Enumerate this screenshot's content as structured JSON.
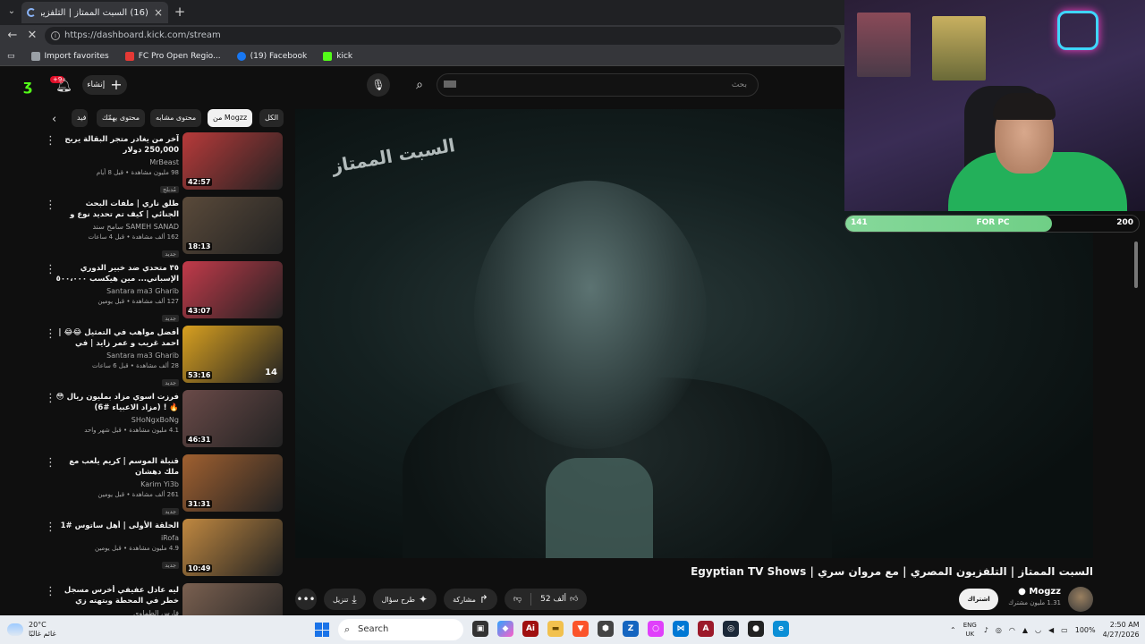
{
  "browser": {
    "tab_title": "(16) السبت الممتاز | التلفزيون المصر",
    "url": "https://dashboard.kick.com/stream",
    "bookmarks": [
      {
        "label": "Import favorites",
        "color": "#9aa0a6"
      },
      {
        "label": "FC Pro Open Regio...",
        "color": "#e53935"
      },
      {
        "label": "(19) Facebook",
        "color": "#1877f2"
      },
      {
        "label": "kick",
        "color": "#53fc18"
      }
    ]
  },
  "header": {
    "notif_badge": "+9",
    "create_label": "إنشاء",
    "search_placeholder": "بحث"
  },
  "chips": [
    {
      "label": "الكل",
      "active": false
    },
    {
      "label": "من Mogzz",
      "active": true
    },
    {
      "label": "محتوى مشابه",
      "active": false
    },
    {
      "label": "محتوى يهمّك",
      "active": false
    },
    {
      "label": "فيد",
      "active": false
    }
  ],
  "videos": [
    {
      "title": "آخر من يغادر متجر البقالة يربح 250,000 دولار",
      "channel": "MrBeast",
      "meta": "98 مليون مشاهدة • قبل 8 أيام",
      "badge": "مُدبلج",
      "duration": "42:57",
      "thumb": "#b83a3a"
    },
    {
      "title": "طلق ناري | ملفات البحث الجنائي | كيف تم تحديد نوع و بصمة السلاح و تفاصيل هامة ...",
      "channel": "SAMEH SANAD سامح سند",
      "meta": "162 ألف مشاهدة • قبل 4 ساعات",
      "badge": "جديد",
      "duration": "18:13",
      "thumb": "#5a4a3a"
    },
    {
      "title": "٣٥ متحدي ضد خبير الدوري الإسباني... مين هيكسب ٥٠٠،٠٠٠ جنيه 😳",
      "channel": "Santara ma3 Gharib",
      "meta": "127 ألف مشاهدة • قبل يومين",
      "badge": "جديد",
      "duration": "43:07",
      "thumb": "#c23a4a"
    },
    {
      "title": "أفضل مواهب في التمثيل 😂😂 | احمد غريب و عمر زايد | في السجين مع سين جيم في ال 70 و",
      "channel": "Santara ma3 Gharib",
      "meta": "28 ألف مشاهدة • قبل 6 ساعات",
      "badge": "جديد",
      "duration": "53:16",
      "thumb": "#d8a020",
      "tag": "14"
    },
    {
      "title": "فرزت اسوي مزاد بمليون ريال 😳🔥 ! (مزاد الاعبياء #6)",
      "channel": "SHoNgxBoNg",
      "meta": "4.1 مليون مشاهدة • قبل شهر واحد",
      "badge": "",
      "duration": "46:31",
      "thumb": "#6a4a48"
    },
    {
      "title": "قنبلة الموسم | كريم يلعب مع ملك دهشان",
      "channel": "Karim Yi3b",
      "meta": "261 ألف مشاهدة • قبل يومين",
      "badge": "جديد",
      "duration": "31:31",
      "thumb": "#a06030"
    },
    {
      "title": "الحلقة الأولى | أهل ساتوس #1",
      "channel": "iRofa",
      "meta": "4.9 مليون مشاهدة • قبل يومين",
      "badge": "جديد",
      "duration": "10:49",
      "thumb": "#c08840"
    },
    {
      "title": "ليه عادل عفيفي أخرس مسجل خطر في المحطة وبتهته زي المسلسلات | حكاوي ...",
      "channel": "فارس الطماوي",
      "meta": "",
      "badge": "",
      "duration": "",
      "thumb": "#7a6050"
    }
  ],
  "player": {
    "watermark": "السبت الممتاز",
    "title": "السبت الممتاز | التلفزيون المصري | مع مروان سري | Egyptian TV Shows"
  },
  "actions": {
    "like_count": "52 ألف",
    "share": "مشاركة",
    "ask": "طرح سؤال",
    "download": "تنزيل"
  },
  "channel": {
    "name": "Mogzz",
    "subs": "1.31 مليون مشترك",
    "subscribe": "اشتراك"
  },
  "goal": {
    "current": "141",
    "label": "FOR PC",
    "target": "200",
    "progress": 0.705
  },
  "taskbar": {
    "temp": "20°C",
    "weather": "غائم غالبًا",
    "search": "Search",
    "lang_top": "ENG",
    "lang_bottom": "UK",
    "battery": "100%",
    "time": "2:50 AM",
    "date": "4/27/2026"
  }
}
